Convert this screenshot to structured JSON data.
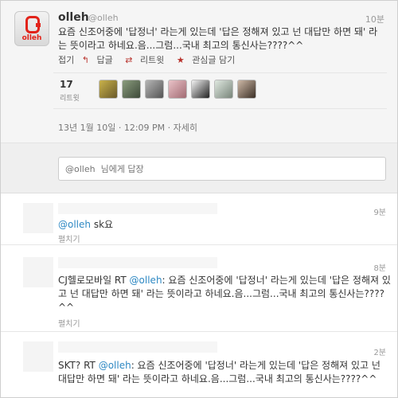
{
  "main_tweet": {
    "brand_logo_text": "olleh",
    "username": "olleh",
    "handle": "@olleh",
    "time": "10분",
    "text_before": "요즘 신조어중에 '답정너' 라는게 있는데 '답은 정해져 있고 넌 대답만 하면 돼' 라는 뜻이라고 하네요.음...그럼...국내 최고의 통신사는????^^",
    "actions": {
      "collapse": "접기",
      "reply": "답글",
      "retweet": "리트윗",
      "favorite": "관심글 담기"
    },
    "retweet_count": "17",
    "retweet_label": "리트윗",
    "timestamp": "13년 1월 10일 · 12:09 PM · 자세히"
  },
  "reply_box": {
    "placeholder": "@olleh  님에게 답장"
  },
  "replies": [
    {
      "time": "9분",
      "mention": "@olleh",
      "text": " sk요",
      "expand": "펼치기"
    },
    {
      "time": "8분",
      "prefix": "CJ헬로모바일 RT ",
      "mention": "@olleh",
      "text": ": 요즘 신조어중에 '답정너' 라는게 있는데 '답은 정해져 있고 넌 대답만 하면 돼' 라는 뜻이라고 하네요.음...그럼...국내 최고의 통신사는????^^",
      "expand": "펼치기"
    },
    {
      "time": "2분",
      "prefix": "SKT? RT ",
      "mention": "@olleh",
      "text": ": 요즘 신조어중에 '답정너' 라는게 있는데 '답은 정해져 있고 넌 대답만 하면 돼' 라는 뜻이라고 하네요.음...그럼...국내 최고의 통신사는????^^"
    }
  ],
  "colors": {
    "link": "#2d88c3",
    "brand_red": "#e2231a"
  }
}
